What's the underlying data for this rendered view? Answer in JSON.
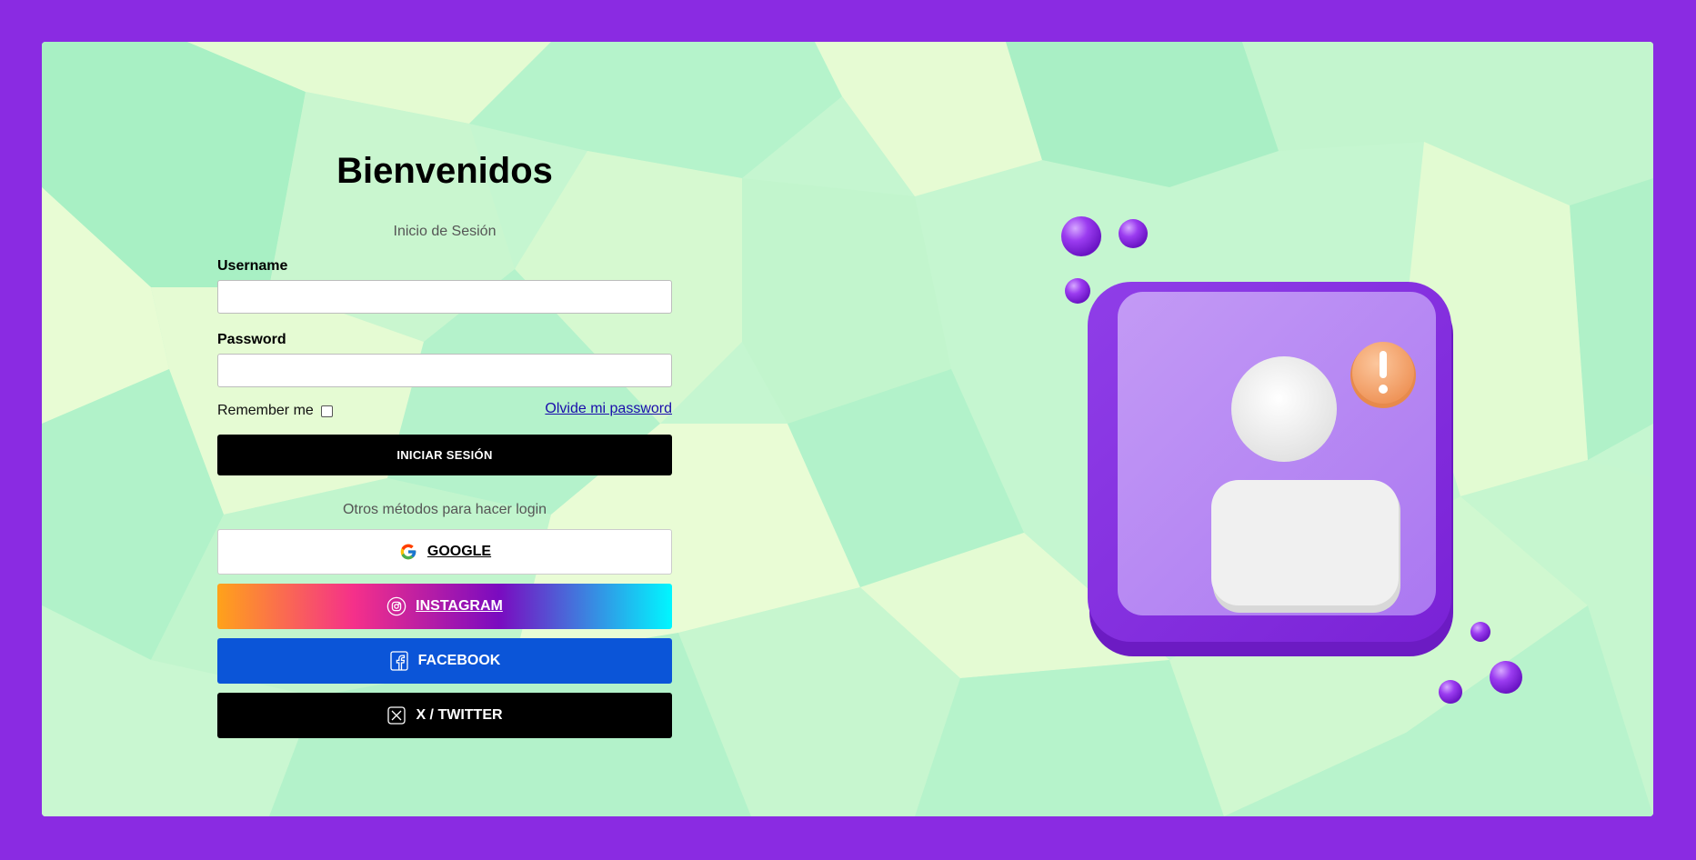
{
  "login": {
    "title": "Bienvenidos",
    "subtitle": "Inicio de Sesión",
    "username_label": "Username",
    "username_value": "",
    "password_label": "Password",
    "password_value": "",
    "remember_label": "Remember me",
    "remember_checked": false,
    "forgot_link": "Olvide mi password",
    "submit_label": "INICIAR SESIÓN",
    "other_methods": "Otros métodos para hacer login"
  },
  "social": {
    "google": "GOOGLE",
    "instagram": "INSTAGRAM",
    "facebook": "FACEBOOK",
    "twitter": "X / TWITTER"
  },
  "icons": {
    "google": "google-icon",
    "instagram": "instagram-icon",
    "facebook": "facebook-icon",
    "twitter": "x-twitter-icon",
    "illustration": "user-profile-alert-icon"
  },
  "colors": {
    "border_frame": "#8a2be2",
    "submit_bg": "#000000",
    "facebook_bg": "#0b55d8",
    "twitter_bg": "#000000",
    "illustration_purple": "#a974f0",
    "alert_badge": "#f4a26b"
  }
}
